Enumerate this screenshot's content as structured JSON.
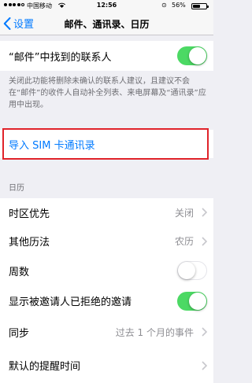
{
  "status_bar": {
    "carrier": "中国移动",
    "time": "12:56",
    "battery_percent": "56%",
    "battery_level": 0.56
  },
  "nav": {
    "back_label": "设置",
    "title": "邮件、通讯录、日历"
  },
  "contacts": {
    "found_in_mail_label": "“邮件”中找到的联系人",
    "found_in_mail_on": true,
    "footer": "关闭此功能将删除未确认的联系人建议，且建议不会在“邮件”的收件人自动补全列表、来电屏幕及“通讯录”应用中出现。",
    "import_sim": "导入 SIM 卡通讯录"
  },
  "calendar": {
    "section_header": "日历",
    "timezone_override": {
      "label": "时区优先",
      "value": "关闭"
    },
    "alternate_calendars": {
      "label": "其他历法",
      "value": "农历"
    },
    "week_numbers": {
      "label": "周数",
      "on": false
    },
    "show_declined": {
      "label": "显示被邀请人已拒绝的邀请",
      "on": true
    },
    "sync": {
      "label": "同步",
      "value": "过去 1 个月的事件"
    },
    "default_alert_times": {
      "label": "默认的提醒时间"
    }
  },
  "colors": {
    "accent": "#007aff",
    "toggle_on": "#4cd964",
    "highlight": "#e0232a"
  }
}
